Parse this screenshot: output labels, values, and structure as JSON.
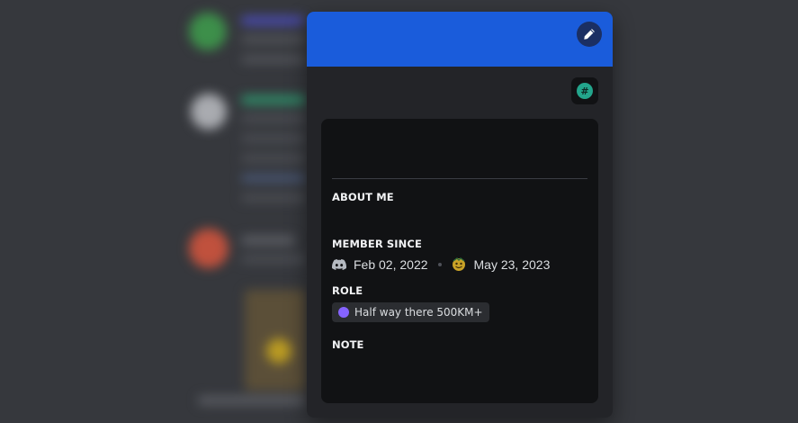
{
  "profile": {
    "banner_color": "#1a5cdb",
    "edit_icon": "pencil-icon",
    "badge_icon": "hashtag-icon",
    "badge_glyph": "#",
    "about_me_title": "ABOUT ME",
    "member_since_title": "MEMBER SINCE",
    "discord_join_date": "Feb 02, 2022",
    "server_join_date": "May 23, 2023",
    "role_title": "ROLE",
    "role_name": "Half way there 500KM+",
    "role_color": "#8563ff",
    "note_title": "NOTE"
  }
}
